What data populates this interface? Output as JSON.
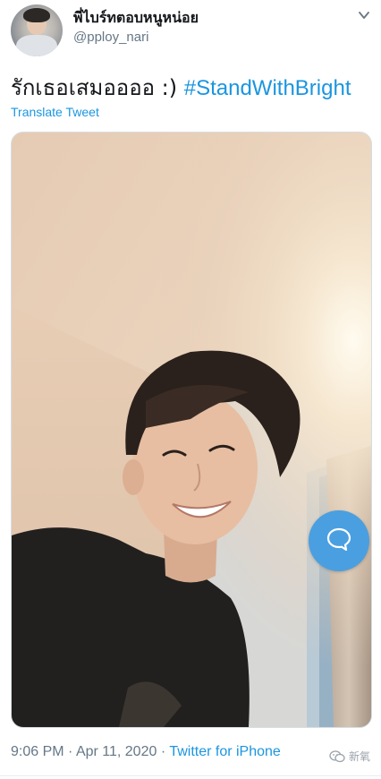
{
  "header": {
    "display_name": "พี่ไบร์ทตอบหนูหน่อย",
    "handle": "@pploy_nari",
    "menu_icon": "chevron-down-icon"
  },
  "tweet": {
    "text": "รักเธอเสมออออ :) ",
    "hashtag": "#StandWithBright",
    "translate_label": "Translate Tweet"
  },
  "media": {
    "type": "photo",
    "overlay_icon": "speech-bubble-icon"
  },
  "footer": {
    "time": "9:06 PM",
    "separator1": " · ",
    "date": "Apr 11, 2020",
    "separator2": " · ",
    "source": "Twitter for iPhone"
  },
  "watermark": {
    "text": "新氧",
    "icon": "wechat-icon"
  },
  "colors": {
    "link": "#1b95e0",
    "secondary_text": "#657786",
    "primary_text": "#14171a",
    "bubble": "#4a9fe0"
  }
}
